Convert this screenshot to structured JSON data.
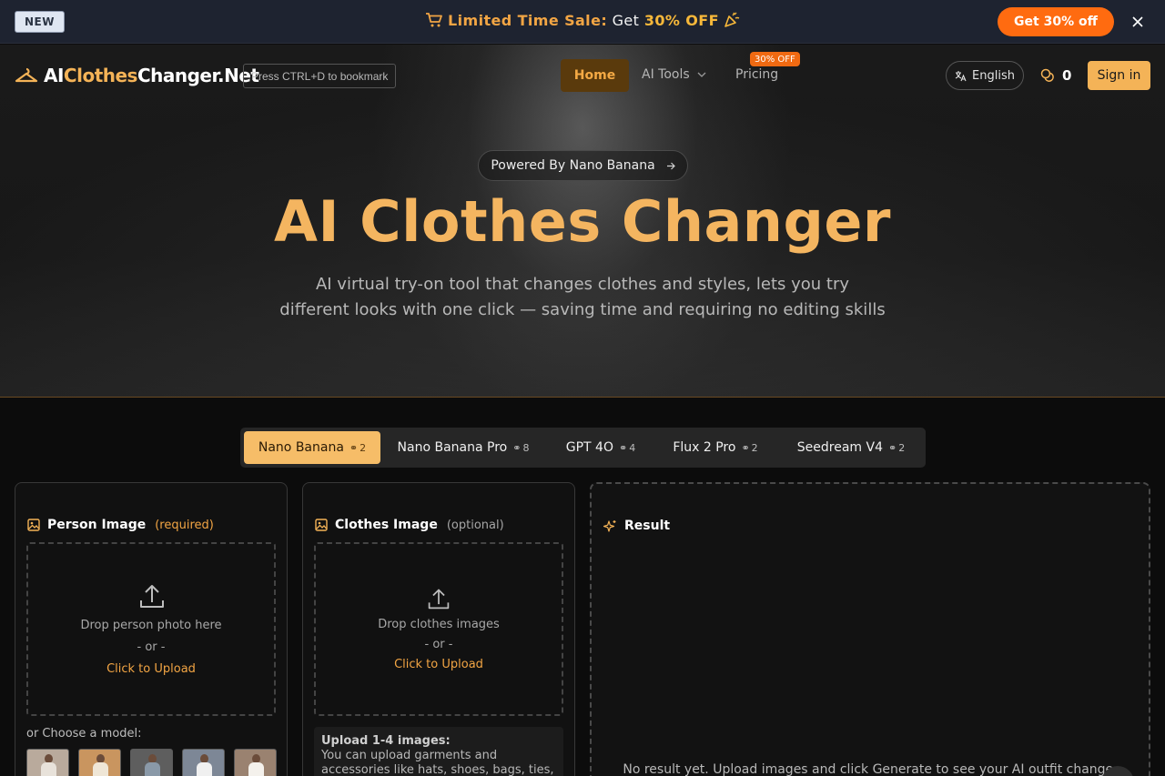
{
  "promo": {
    "new_badge": "NEW",
    "sale_label": "Limited Time Sale:",
    "get_label": "Get",
    "off_label": "30% OFF",
    "cta": "Get 30% off"
  },
  "nav": {
    "logo_part1": "AI",
    "logo_part2": "Clothes",
    "logo_part3": "Changer.Net",
    "bookmark_hint": "Press CTRL+D to bookmark",
    "home": "Home",
    "ai_tools": "AI Tools",
    "pricing": "Pricing",
    "pricing_badge": "30% OFF",
    "language": "English",
    "credits": "0",
    "sign_in": "Sign in"
  },
  "hero": {
    "powered_by": "Powered By Nano Banana",
    "title": "AI Clothes Changer",
    "subtitle_line1": "AI virtual try-on tool that changes clothes and styles, lets you try",
    "subtitle_line2": "different looks with one click — saving time and requiring no editing skills"
  },
  "model_tabs": [
    {
      "label": "Nano Banana",
      "cost": "2",
      "active": true
    },
    {
      "label": "Nano Banana Pro",
      "cost": "8",
      "active": false
    },
    {
      "label": "GPT 4O",
      "cost": "4",
      "active": false
    },
    {
      "label": "Flux 2 Pro",
      "cost": "2",
      "active": false
    },
    {
      "label": "Seedream V4",
      "cost": "2",
      "active": false
    }
  ],
  "person_panel": {
    "title": "Person Image",
    "required": "(required)",
    "drop_hint": "Drop person photo here",
    "or": "- or -",
    "click": "Click to Upload",
    "choose_model": "or Choose a model:"
  },
  "clothes_panel": {
    "title": "Clothes Image",
    "optional": "(optional)",
    "drop_hint": "Drop clothes images",
    "or": "- or -",
    "click": "Click to Upload",
    "info_title": "Upload 1-4 images:",
    "info_line1": "You can upload garments and",
    "info_line2": "accessories like hats, shoes, bags, ties,"
  },
  "result_panel": {
    "title": "Result",
    "empty_text": "No result yet. Upload images and click Generate to see your AI outfit change."
  },
  "colors": {
    "accent": "#f4b357",
    "cta_orange": "#ff6b10",
    "active_tab": "#f6bd68"
  }
}
